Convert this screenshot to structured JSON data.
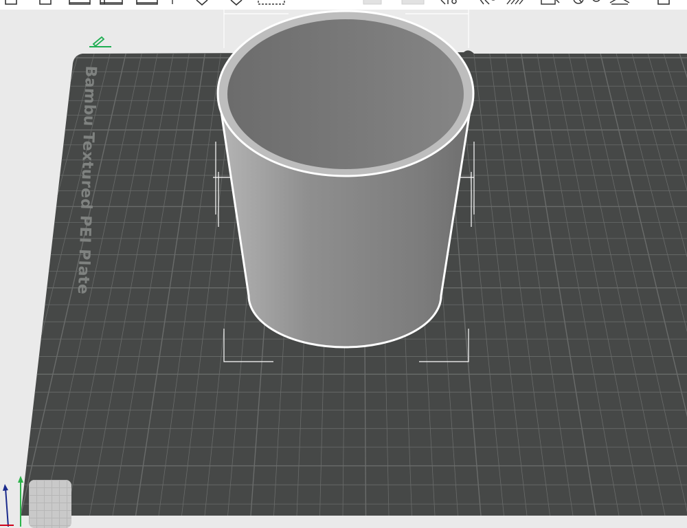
{
  "app": {
    "title": ""
  },
  "toolbar": {
    "icons": [
      "plate-icon",
      "add-plate-icon",
      "arrange-icon",
      "orient-icon",
      "lay-flat-icon",
      "split-icon",
      "cut-icon",
      "move-icon",
      "rotate-icon",
      "scale-icon",
      "support-paint-icon",
      "seam-paint-icon",
      "color-paint-icon",
      "text-icon",
      "measure-icon",
      "assembly-icon",
      "variable-height-icon",
      "overflow-icon"
    ]
  },
  "viewport": {
    "plate_name": "Bambu Textured PEI Plate",
    "object": "cylinder-cup",
    "plate_color": "#464847",
    "grid_color": "#6a6c6b",
    "object_color": "#8a8a8a",
    "outline_color": "#ffffff",
    "selection_color": "#ffffff",
    "edit_icon_color": "#1fae52",
    "background_color": "#eaeaea"
  },
  "axes": {
    "x_color": "#d0021b",
    "y_color": "#2db34a",
    "z_color": "#1a2a8c"
  }
}
